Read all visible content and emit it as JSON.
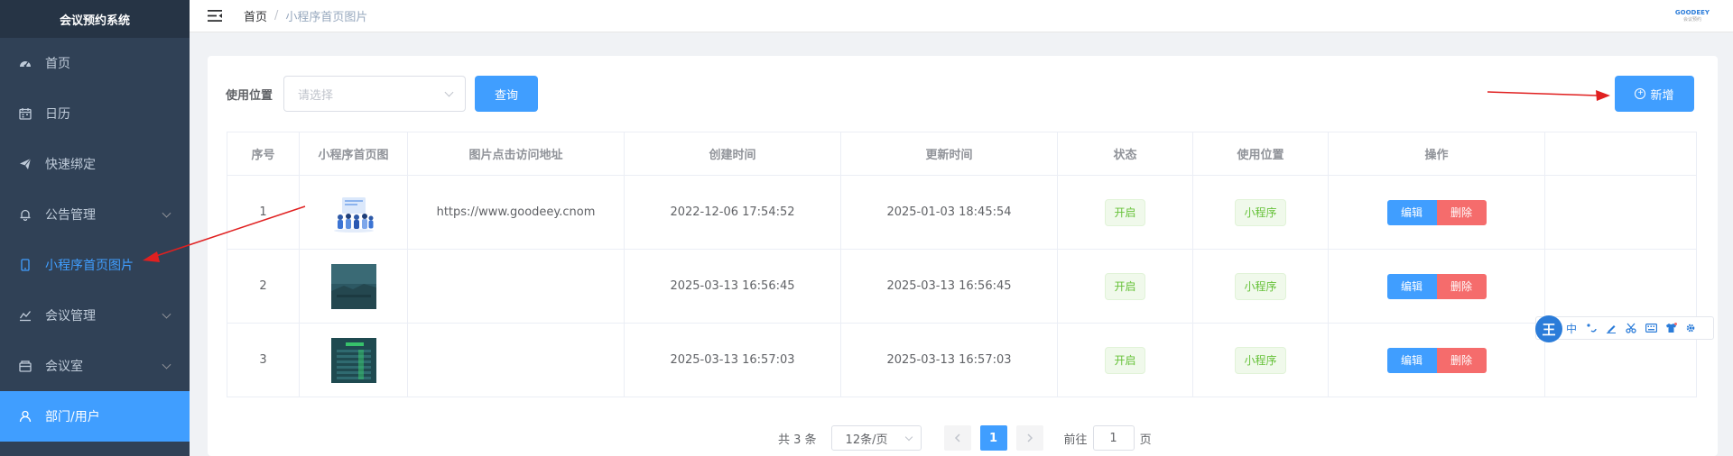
{
  "app": {
    "title": "会议预约系统"
  },
  "sidebar": {
    "items": [
      {
        "label": "首页",
        "icon": "dashboard-icon"
      },
      {
        "label": "日历",
        "icon": "calendar-icon"
      },
      {
        "label": "快速绑定",
        "icon": "send-icon"
      },
      {
        "label": "公告管理",
        "icon": "bell-icon",
        "expandable": true
      },
      {
        "label": "小程序首页图片",
        "icon": "phone-icon",
        "active": true
      },
      {
        "label": "会议管理",
        "icon": "chart-icon",
        "expandable": true
      },
      {
        "label": "会议室",
        "icon": "folder-icon",
        "expandable": true
      },
      {
        "label": "部门/用户",
        "icon": "user-icon",
        "highlight": true
      }
    ]
  },
  "breadcrumb": {
    "home": "首页",
    "separator": "/",
    "current": "小程序首页图片"
  },
  "header": {
    "logo_text": "GOODEEY",
    "logo_sub": "会议预约"
  },
  "filter": {
    "label": "使用位置",
    "placeholder": "请选择",
    "query_label": "查询"
  },
  "toolbar": {
    "add_label": "新增"
  },
  "table": {
    "columns": [
      "序号",
      "小程序首页图",
      "图片点击访问地址",
      "创建时间",
      "更新时间",
      "状态",
      "使用位置",
      "操作"
    ],
    "rows": [
      {
        "index": "1",
        "url": "https://www.goodeey.cnom",
        "created": "2022-12-06 17:54:52",
        "updated": "2025-01-03 18:45:54",
        "status": "开启",
        "position": "小程序",
        "edit": "编辑",
        "delete": "删除",
        "thumb": "people-illustration"
      },
      {
        "index": "2",
        "url": "",
        "created": "2025-03-13 16:56:45",
        "updated": "2025-03-13 16:56:45",
        "status": "开启",
        "position": "小程序",
        "edit": "编辑",
        "delete": "删除",
        "thumb": "dark-teal-photo"
      },
      {
        "index": "3",
        "url": "",
        "created": "2025-03-13 16:57:03",
        "updated": "2025-03-13 16:57:03",
        "status": "开启",
        "position": "小程序",
        "edit": "编辑",
        "delete": "删除",
        "thumb": "app-screenshot"
      }
    ]
  },
  "pagination": {
    "total": "共 3 条",
    "page_size": "12条/页",
    "current_page": "1",
    "goto_prefix": "前往",
    "goto_value": "1",
    "goto_suffix": "页"
  },
  "ime": {
    "logo": "王",
    "lang": "中"
  },
  "colors": {
    "primary": "#409eff",
    "danger": "#f56c6c",
    "success": "#67c23a",
    "sidebar": "#304156",
    "arrow": "#e02020"
  }
}
